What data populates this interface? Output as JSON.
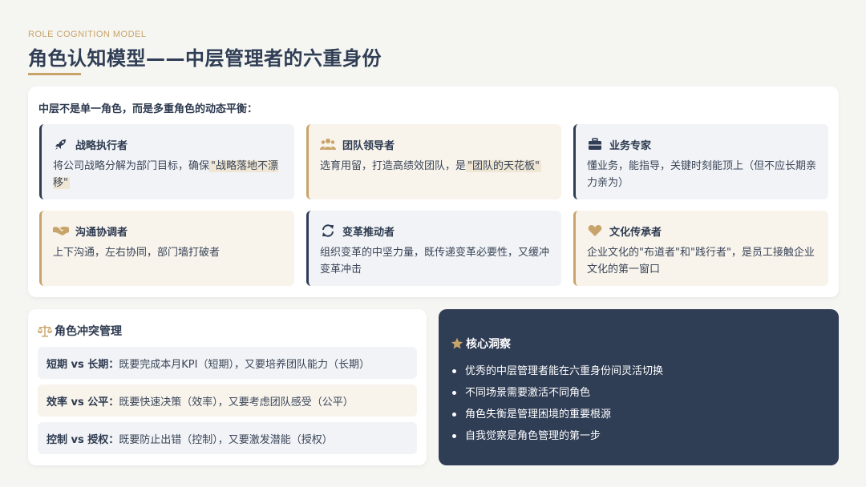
{
  "header": {
    "eyebrow": "ROLE COGNITION MODEL",
    "title": "角色认知模型——中层管理者的六重身份"
  },
  "roles": {
    "intro": "中层不是单一角色，而是多重角色的动态平衡：",
    "items": [
      {
        "icon": "rocket-icon",
        "name": "战略执行者",
        "desc_pre": "将公司战略分解为部门目标，确保",
        "desc_hl": "\"战略落地不漂移\"",
        "desc_post": ""
      },
      {
        "icon": "team-icon",
        "name": "团队领导者",
        "desc_pre": "选育用留，打造高绩效团队，是",
        "desc_hl": "\"团队的天花板\"",
        "desc_post": ""
      },
      {
        "icon": "briefcase-icon",
        "name": "业务专家",
        "desc_pre": "懂业务，能指导，关键时刻能顶上（但不应长期亲力亲为）",
        "desc_hl": "",
        "desc_post": ""
      },
      {
        "icon": "handshake-icon",
        "name": "沟通协调者",
        "desc_pre": "上下沟通，左右协同，部门墙打破者",
        "desc_hl": "",
        "desc_post": ""
      },
      {
        "icon": "refresh-icon",
        "name": "变革推动者",
        "desc_pre": "组织变革的中坚力量，既传递变革必要性，又缓冲变革冲击",
        "desc_hl": "",
        "desc_post": ""
      },
      {
        "icon": "heart-icon",
        "name": "文化传承者",
        "desc_pre": "企业文化的\"布道者\"和\"践行者\"，是员工接触企业文化的第一窗口",
        "desc_hl": "",
        "desc_post": ""
      }
    ]
  },
  "conflict": {
    "title": "角色冲突管理",
    "rows": [
      {
        "label": "短期 vs 长期：",
        "text": "既要完成本月KPI（短期），又要培养团队能力（长期）"
      },
      {
        "label": "效率 vs 公平：",
        "text": "既要快速决策（效率），又要考虑团队感受（公平）"
      },
      {
        "label": "控制 vs 授权：",
        "text": "既要防止出错（控制），又要激发潜能（授权）"
      }
    ]
  },
  "insight": {
    "title": "核心洞察",
    "items": [
      "优秀的中层管理者能在六重身份间灵活切换",
      "不同场景需要激活不同角色",
      "角色失衡是管理困境的重要根源",
      "自我觉察是角色管理的第一步"
    ]
  },
  "colors": {
    "navy": "#2f3d55",
    "gold": "#c9a46a",
    "background": "#f5f5f1"
  }
}
